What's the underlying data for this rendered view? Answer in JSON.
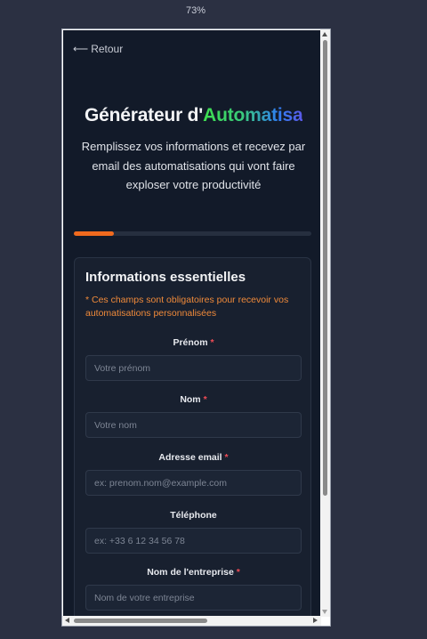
{
  "zoom": "73%",
  "back": {
    "icon": "arrow-left-icon",
    "label": "Retour"
  },
  "header": {
    "title_plain": "Générateur d'",
    "title_highlight": "Automatisa",
    "subtitle": "Remplissez vos informations et recevez par email des automatisations qui vont faire exploser votre productivité"
  },
  "progress": {
    "value": 0.17,
    "color": "#f06a1e"
  },
  "form": {
    "title": "Informations essentielles",
    "note": "* Ces champs sont obligatoires pour recevoir vos automatisations personnalisées",
    "required_marker": "*",
    "fields": [
      {
        "label": "Prénom",
        "required": true,
        "placeholder": "Votre prénom",
        "value": ""
      },
      {
        "label": "Nom",
        "required": true,
        "placeholder": "Votre nom",
        "value": ""
      },
      {
        "label": "Adresse email",
        "required": true,
        "placeholder": "ex: prenom.nom@example.com",
        "value": ""
      },
      {
        "label": "Téléphone",
        "required": false,
        "placeholder": "ex: +33 6 12 34 56 78",
        "value": ""
      },
      {
        "label": "Nom de l'entreprise",
        "required": true,
        "placeholder": "Nom de votre entreprise",
        "value": ""
      }
    ]
  },
  "colors": {
    "background": "#121a29",
    "card": "#18202f",
    "accent_orange": "#f06a1e",
    "required_red": "#ef4b55"
  }
}
